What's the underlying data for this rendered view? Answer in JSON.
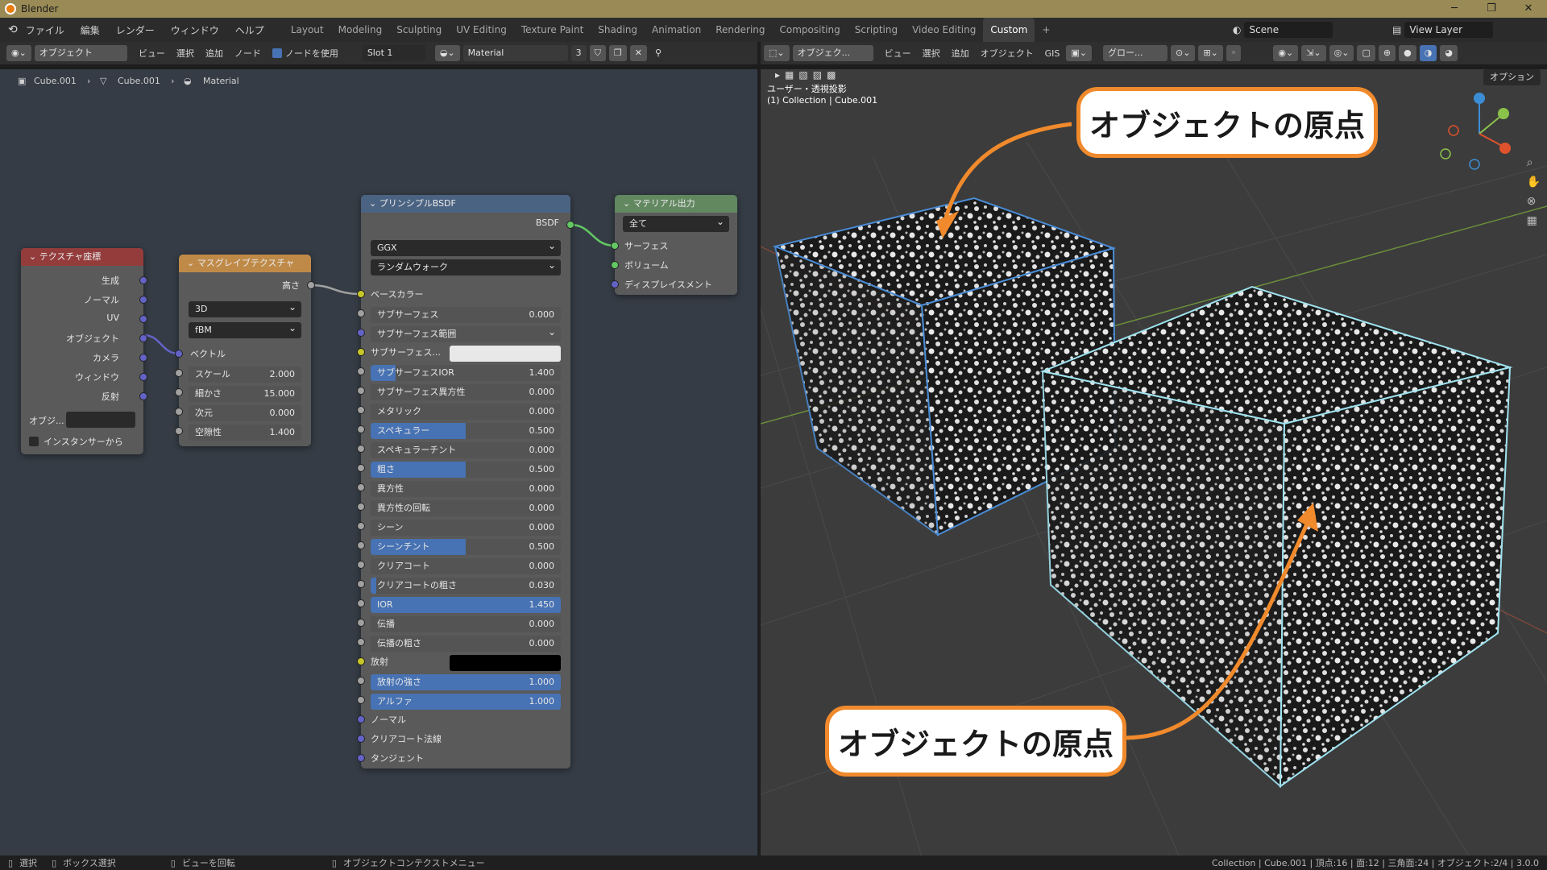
{
  "app": {
    "title": "Blender"
  },
  "menu": [
    "ファイル",
    "編集",
    "レンダー",
    "ウィンドウ",
    "ヘルプ"
  ],
  "workspaces": [
    "Layout",
    "Modeling",
    "Sculpting",
    "UV Editing",
    "Texture Paint",
    "Shading",
    "Animation",
    "Rendering",
    "Compositing",
    "Scripting",
    "Video Editing",
    "Custom"
  ],
  "active_workspace": "Custom",
  "scene": "Scene",
  "view_layer": "View Layer",
  "node_header": {
    "mode": "オブジェクト",
    "items": [
      "ビュー",
      "選択",
      "追加",
      "ノード"
    ],
    "use_nodes": "ノードを使用",
    "slot": "Slot 1",
    "material": "Material",
    "users": "3"
  },
  "breadcrumb": [
    "Cube.001",
    "Cube.001",
    "Material"
  ],
  "viewport_header": {
    "mode": "オブジェク...",
    "items": [
      "ビュー",
      "選択",
      "追加",
      "オブジェクト",
      "GIS"
    ],
    "transform": "グロー...",
    "options": "オプション"
  },
  "viewport_info": {
    "view": "ユーザー・透視投影",
    "collection": "(1) Collection | Cube.001"
  },
  "nodes": {
    "texcoord": {
      "title": "テクスチャ座標",
      "outputs": [
        "生成",
        "ノーマル",
        "UV",
        "オブジェクト",
        "カメラ",
        "ウィンドウ",
        "反射"
      ],
      "object_label": "オブジ...",
      "from_instancer": "インスタンサーから"
    },
    "musgrave": {
      "title": "マスグレイブテクスチャ",
      "output": "高さ",
      "dim": "3D",
      "type": "fBM",
      "vector": "ベクトル",
      "params": [
        {
          "label": "スケール",
          "value": "2.000"
        },
        {
          "label": "細かさ",
          "value": "15.000"
        },
        {
          "label": "次元",
          "value": "0.000"
        },
        {
          "label": "空隙性",
          "value": "1.400"
        }
      ]
    },
    "bsdf": {
      "title": "プリンシプルBSDF",
      "output": "BSDF",
      "distribution": "GGX",
      "subsurface_method": "ランダムウォーク",
      "base_color": "ベースカラー",
      "subsurface": {
        "label": "サブサーフェス",
        "value": "0.000"
      },
      "subsurface_radius": "サブサーフェス範囲",
      "subsurface_color": "サブサーフェス...",
      "params": [
        {
          "label": "サブサーフェスIOR",
          "value": "1.400",
          "fill": 0.13
        },
        {
          "label": "サブサーフェス異方性",
          "value": "0.000",
          "fill": 0
        },
        {
          "label": "メタリック",
          "value": "0.000",
          "fill": 0
        },
        {
          "label": "スペキュラー",
          "value": "0.500",
          "fill": 0.5
        },
        {
          "label": "スペキュラーチント",
          "value": "0.000",
          "fill": 0
        },
        {
          "label": "粗さ",
          "value": "0.500",
          "fill": 0.5
        },
        {
          "label": "異方性",
          "value": "0.000",
          "fill": 0
        },
        {
          "label": "異方性の回転",
          "value": "0.000",
          "fill": 0
        },
        {
          "label": "シーン",
          "value": "0.000",
          "fill": 0
        },
        {
          "label": "シーンチント",
          "value": "0.500",
          "fill": 0.5
        },
        {
          "label": "クリアコート",
          "value": "0.000",
          "fill": 0
        },
        {
          "label": "クリアコートの粗さ",
          "value": "0.030",
          "fill": 0.03
        },
        {
          "label": "IOR",
          "value": "1.450",
          "fill": 1
        },
        {
          "label": "伝播",
          "value": "0.000",
          "fill": 0
        },
        {
          "label": "伝播の粗さ",
          "value": "0.000",
          "fill": 0
        }
      ],
      "emission": "放射",
      "emission_strength": {
        "label": "放射の強さ",
        "value": "1.000"
      },
      "alpha": {
        "label": "アルファ",
        "value": "1.000"
      },
      "normal": "ノーマル",
      "clearcoat_normal": "クリアコート法線",
      "tangent": "タンジェント"
    },
    "output": {
      "title": "マテリアル出力",
      "target": "全て",
      "inputs": [
        "サーフェス",
        "ボリューム",
        "ディスプレイスメント"
      ]
    }
  },
  "callouts": [
    "オブジェクトの原点",
    "オブジェクトの原点"
  ],
  "status": {
    "select": "選択",
    "box_select": "ボックス選択",
    "rotate": "ビューを回転",
    "context": "オブジェクトコンテクストメニュー",
    "stats": "Collection | Cube.001 | 頂点:16 | 面:12 | 三角面:24 | オブジェクト:2/4 | 3.0.0"
  },
  "colors": {
    "accent": "#f08a2c",
    "slider": "#4772b3",
    "musgrave_header": "#bf8a48",
    "bsdf_header": "#4b6382",
    "output_header": "#628860"
  }
}
